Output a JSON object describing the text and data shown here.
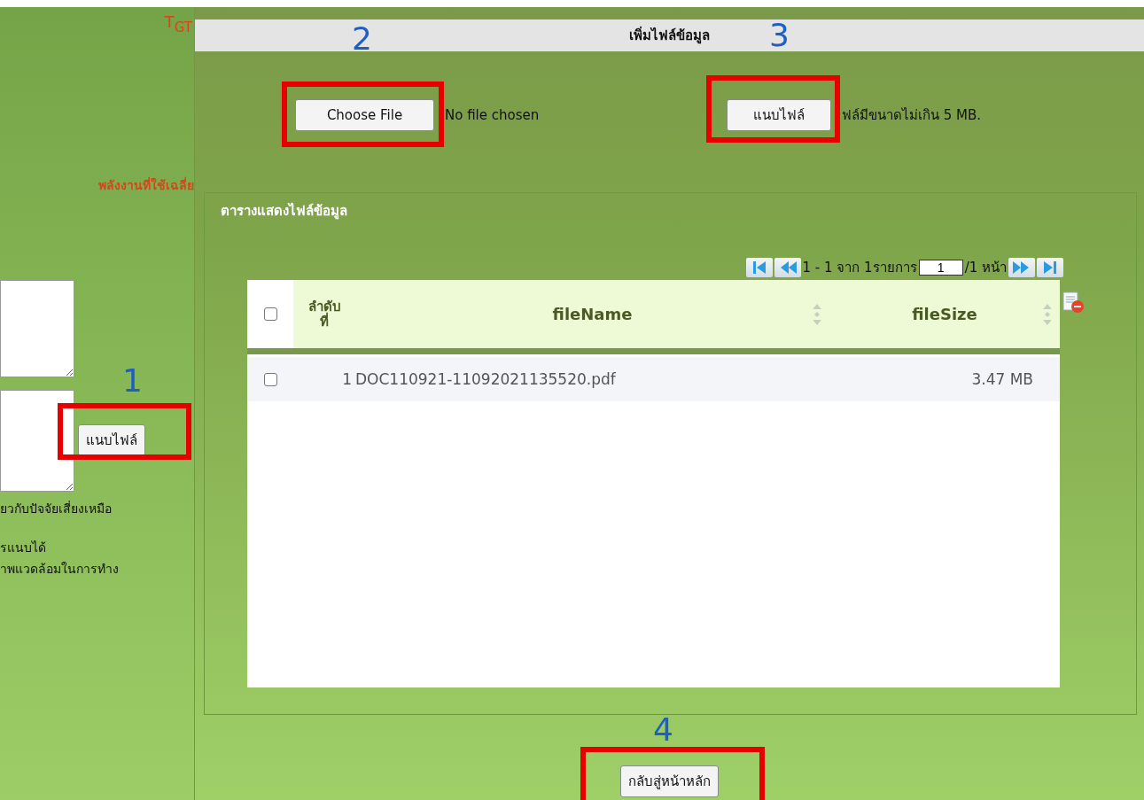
{
  "background_form": {
    "heading": "T$_{GT}$",
    "energy_label": "พลังงานที่ใช้เฉลี่ย",
    "attach_button": "แนบไฟล์",
    "notes": [
      "ยวกับปัจจัยเสี่ยงเหมือ",
      "รแนบได้",
      "าพแวดล้อมในการทำง"
    ]
  },
  "dialog": {
    "title": "เพิ่มไฟล์ข้อมูล",
    "choose_file_button": "Choose File",
    "file_status": "No file chosen",
    "attach_button": "แนบไฟล์",
    "size_note": "ฟล์มีขนาดไม่เกิน 5 MB.",
    "legend": "ตารางแสดงไฟล์ข้อมูล",
    "pager": {
      "range_text": "1 - 1 จาก 1รายการ",
      "page_value": "1",
      "page_total": "/1 หน้า"
    },
    "table": {
      "header_checked": false,
      "columns": [
        "ลำดับ ที่",
        "fileName",
        "fileSize"
      ],
      "rows": [
        {
          "checked": false,
          "index": "1",
          "file_name": "DOC110921-11092021135520.pdf",
          "file_size": "3.47 MB"
        }
      ]
    },
    "back_button": "กลับสู่หน้าหลัก"
  },
  "annotations": [
    {
      "label": "1"
    },
    {
      "label": "2"
    },
    {
      "label": "3"
    },
    {
      "label": "4"
    }
  ]
}
